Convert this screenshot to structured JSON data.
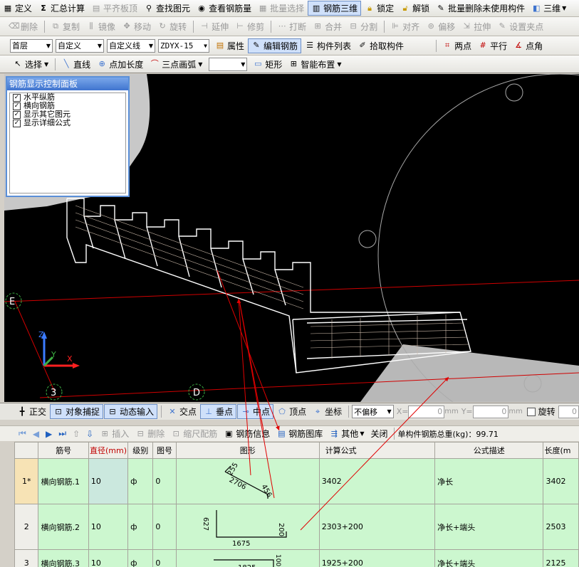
{
  "toolbar1": {
    "items": [
      "定义",
      "汇总计算",
      "平齐板顶",
      "查找图元",
      "查看钢筋量",
      "批量选择",
      "钢筋三维",
      "锁定",
      "解锁",
      "批量删除未使用构件",
      "三维"
    ]
  },
  "toolbar2": {
    "items": [
      "删除",
      "复制",
      "镜像",
      "移动",
      "旋转",
      "延伸",
      "修剪",
      "打断",
      "合并",
      "分割",
      "对齐",
      "偏移",
      "拉伸",
      "设置夹点"
    ]
  },
  "toolbar3": {
    "floor": "首层",
    "type1": "自定义",
    "type2": "自定义线",
    "element": "ZDYX-15",
    "items": [
      "属性",
      "编辑钢筋",
      "构件列表",
      "拾取构件",
      "两点",
      "平行",
      "点角"
    ]
  },
  "toolbar4": {
    "items": [
      "选择",
      "直线",
      "点加长度",
      "三点画弧",
      "矩形",
      "智能布置"
    ]
  },
  "panel": {
    "title": "钢筋显示控制面板",
    "options": [
      "水平纵筋",
      "横向钢筋",
      "显示其它图元",
      "显示详细公式"
    ]
  },
  "viewport": {
    "axis_e": "E",
    "axis_3": "3",
    "axis_d": "D",
    "z_label": "Z",
    "y_label": "Y",
    "x_label": "X"
  },
  "snapbar": {
    "items": [
      "正交",
      "对象捕捉",
      "动态输入",
      "交点",
      "垂点",
      "中点",
      "顶点",
      "坐标"
    ],
    "offset": "不偏移",
    "x_label": "X=",
    "x_value": "0",
    "y_label": "Y=",
    "y_value": "0",
    "unit": "mm",
    "rotate": "旋转",
    "rotate_value": "0"
  },
  "gridbar": {
    "items": [
      "插入",
      "删除",
      "缩尺配筋",
      "钢筋信息",
      "钢筋图库",
      "其他",
      "关闭"
    ],
    "total_weight": "单构件钢筋总重(kg)：99.71"
  },
  "table": {
    "headers": [
      "筋号",
      "直径(mm)",
      "级别",
      "图号",
      "图形",
      "计算公式",
      "公式描述",
      "长度(m"
    ],
    "rows": [
      {
        "idx": "1*",
        "name": "横向钢筋.1",
        "dia": "10",
        "grade": "ф",
        "fig": "0",
        "formula": "3402",
        "desc": "净长",
        "len": "3402",
        "shape_labels": [
          "255",
          "2706",
          "456"
        ]
      },
      {
        "idx": "2",
        "name": "横向钢筋.2",
        "dia": "10",
        "grade": "ф",
        "fig": "0",
        "formula": "2303+200",
        "desc": "净长+端头",
        "len": "2503",
        "shape_labels": [
          "627",
          "1675",
          "200"
        ]
      },
      {
        "idx": "3",
        "name": "横向钢筋.3",
        "dia": "10",
        "grade": "ф",
        "fig": "0",
        "formula": "1925+200",
        "desc": "净长+端头",
        "len": "2125",
        "shape_labels": [
          "1825",
          "100"
        ]
      }
    ]
  },
  "colors": {
    "viewport_bg": "#000000",
    "axis_red": "#d00000",
    "selected_blue": "#cfe0fa"
  }
}
